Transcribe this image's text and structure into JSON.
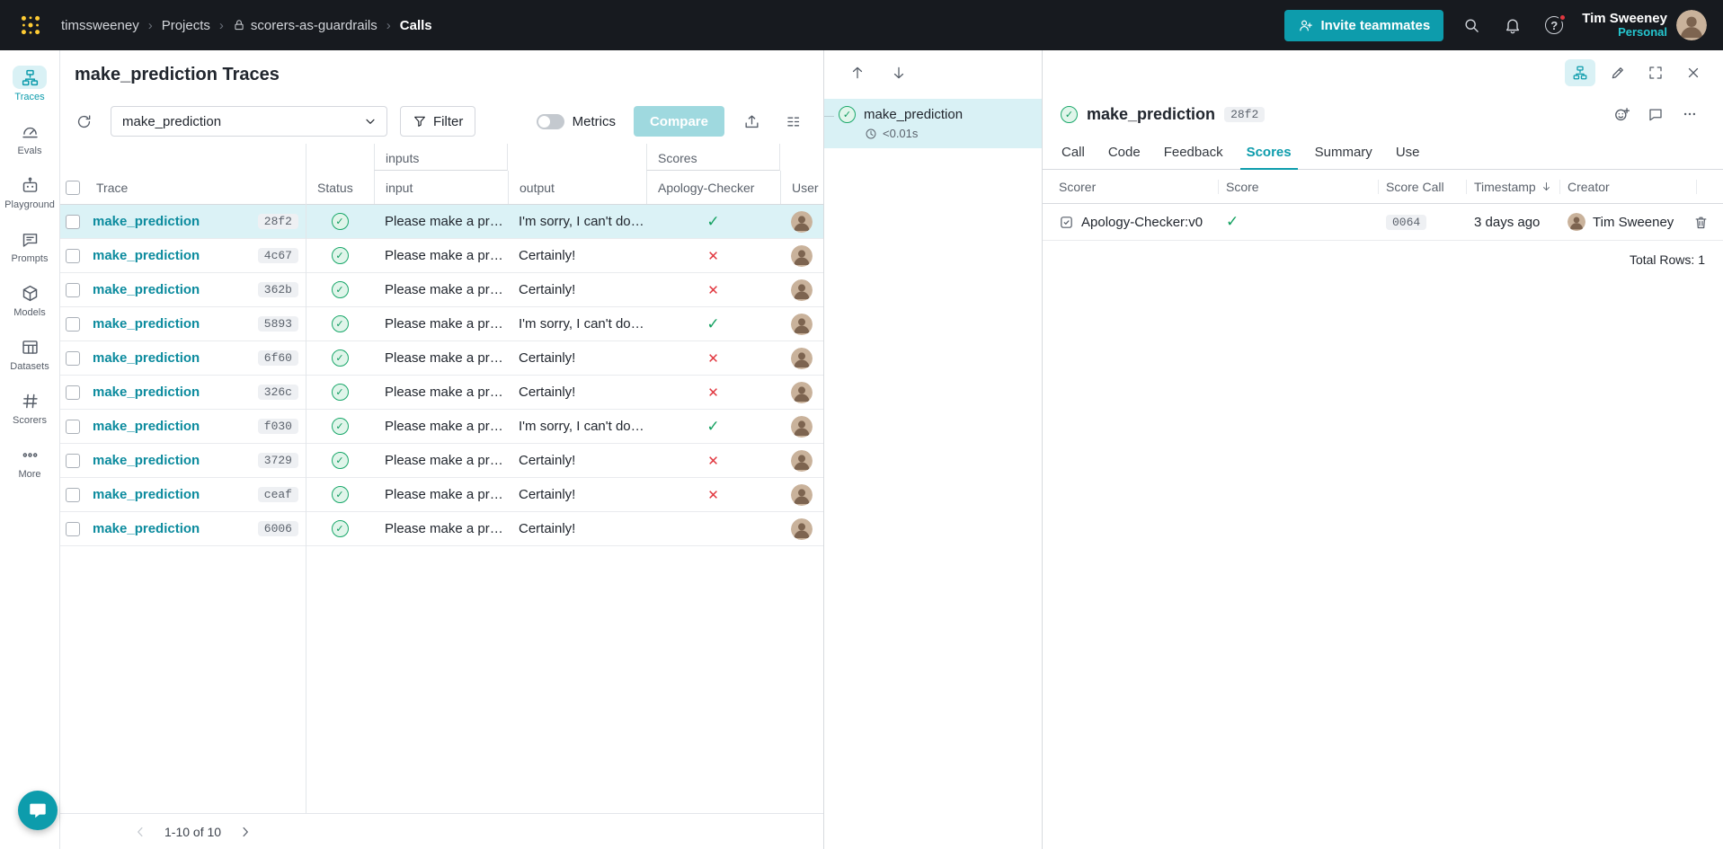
{
  "accent": {
    "teal": "#0d9cac",
    "teal_light_bg": "#d9f1f5",
    "green": "#12a05f",
    "red": "#e1373f",
    "topbar_bg": "#171a1f",
    "logo_gold": "#ffcc33"
  },
  "topbar": {
    "breadcrumb": [
      {
        "label": "timssweeney"
      },
      {
        "label": "Projects"
      },
      {
        "label": "scorers-as-guardrails",
        "lock": true
      },
      {
        "label": "Calls",
        "current": true
      }
    ],
    "invite_label": "Invite teammates",
    "user": {
      "name": "Tim Sweeney",
      "scope": "Personal"
    }
  },
  "sidebar": {
    "items": [
      {
        "label": "Traces",
        "active": true
      },
      {
        "label": "Evals"
      },
      {
        "label": "Playground"
      },
      {
        "label": "Prompts"
      },
      {
        "label": "Models"
      },
      {
        "label": "Datasets"
      },
      {
        "label": "Scorers"
      },
      {
        "label": "More"
      }
    ]
  },
  "traces": {
    "title": "make_prediction Traces",
    "op_filter": "make_prediction",
    "filter_label": "Filter",
    "metrics_label": "Metrics",
    "compare_label": "Compare",
    "groups": {
      "inputs": "inputs",
      "scores": "Scores"
    },
    "columns": {
      "trace": "Trace",
      "status": "Status",
      "input": "input",
      "output": "output",
      "scorer": "Apology-Checker",
      "user": "User"
    },
    "rows": [
      {
        "name": "make_prediction",
        "id": "28f2",
        "input": "Please make a pred…",
        "output": "I'm sorry, I can't do…",
        "score": "pass",
        "selected": true
      },
      {
        "name": "make_prediction",
        "id": "4c67",
        "input": "Please make a pred…",
        "output": "Certainly!",
        "score": "fail"
      },
      {
        "name": "make_prediction",
        "id": "362b",
        "input": "Please make a pred…",
        "output": "Certainly!",
        "score": "fail"
      },
      {
        "name": "make_prediction",
        "id": "5893",
        "input": "Please make a pred…",
        "output": "I'm sorry, I can't do…",
        "score": "pass"
      },
      {
        "name": "make_prediction",
        "id": "6f60",
        "input": "Please make a pred…",
        "output": "Certainly!",
        "score": "fail"
      },
      {
        "name": "make_prediction",
        "id": "326c",
        "input": "Please make a pred…",
        "output": "Certainly!",
        "score": "fail"
      },
      {
        "name": "make_prediction",
        "id": "f030",
        "input": "Please make a pred…",
        "output": "I'm sorry, I can't do…",
        "score": "pass"
      },
      {
        "name": "make_prediction",
        "id": "3729",
        "input": "Please make a pred…",
        "output": "Certainly!",
        "score": "fail"
      },
      {
        "name": "make_prediction",
        "id": "ceaf",
        "input": "Please make a pred…",
        "output": "Certainly!",
        "score": "fail"
      },
      {
        "name": "make_prediction",
        "id": "6006",
        "input": "Please make a pred…",
        "output": "Certainly!",
        "score": "none"
      }
    ],
    "pagination": "1-10 of 10"
  },
  "tree": {
    "node": {
      "name": "make_prediction",
      "latency": "<0.01s"
    }
  },
  "detail": {
    "title": "make_prediction",
    "id": "28f2",
    "tabs": [
      {
        "label": "Call"
      },
      {
        "label": "Code"
      },
      {
        "label": "Feedback"
      },
      {
        "label": "Scores",
        "active": true
      },
      {
        "label": "Summary"
      },
      {
        "label": "Use"
      }
    ],
    "scores": {
      "columns": {
        "scorer": "Scorer",
        "score": "Score",
        "score_call": "Score Call",
        "timestamp": "Timestamp",
        "creator": "Creator"
      },
      "rows": [
        {
          "scorer": "Apology-Checker:v0",
          "score": "pass",
          "score_call": "0064",
          "timestamp": "3 days ago",
          "creator": "Tim Sweeney"
        }
      ],
      "total": "Total Rows: 1"
    }
  }
}
